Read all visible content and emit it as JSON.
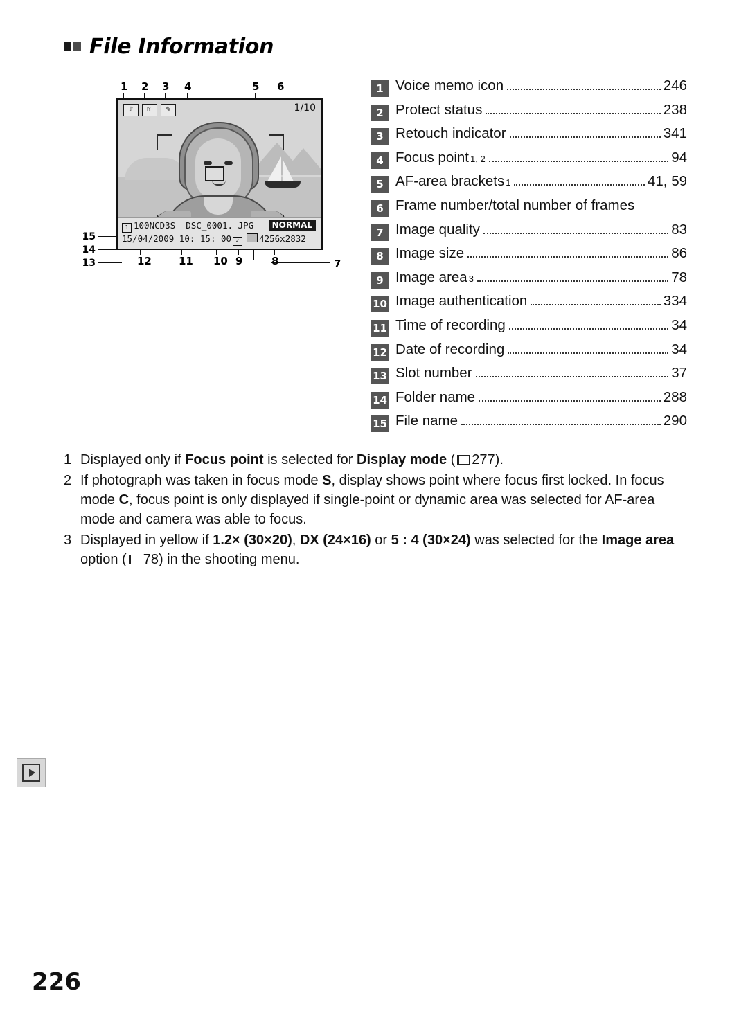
{
  "heading": {
    "title": "File Information"
  },
  "figure": {
    "callouts_top": [
      "1",
      "2",
      "3",
      "4",
      "5",
      "6"
    ],
    "callouts_bottom": [
      "12",
      "11",
      "10",
      "9",
      "8"
    ],
    "callouts_left": [
      "15",
      "14",
      "13"
    ],
    "callouts_right": [
      "7"
    ],
    "monitor": {
      "icons": [
        "voice-memo-icon",
        "protect-icon",
        "retouch-icon"
      ],
      "frame_counter": "1/10",
      "file_folder": "100NCD3S",
      "file_name": "DSC_0001. JPG",
      "quality_badge": "NORMAL",
      "date": "15/04/2009",
      "time": "10: 15: 00",
      "image_size": "4256x2832"
    }
  },
  "legend": [
    {
      "num": "1",
      "label": "Voice memo icon",
      "page": "246",
      "dots": true
    },
    {
      "num": "2",
      "label": "Protect status",
      "page": "238",
      "dots": true
    },
    {
      "num": "3",
      "label": "Retouch indicator",
      "page": "341",
      "dots": true
    },
    {
      "num": "4",
      "label": "Focus point",
      "sup": "1, 2",
      "page": "94",
      "dots": true
    },
    {
      "num": "5",
      "label": "AF-area brackets",
      "sup": "1",
      "page": "41, 59",
      "dots": true
    },
    {
      "num": "6",
      "label": "Frame number/total number of frames",
      "page": "",
      "dots": false
    },
    {
      "num": "7",
      "label": "Image quality",
      "page": "83",
      "dots": true
    },
    {
      "num": "8",
      "label": "Image size",
      "page": "86",
      "dots": true
    },
    {
      "num": "9",
      "label": "Image area",
      "sup": "3",
      "page": "78",
      "dots": true
    },
    {
      "num": "10",
      "label": "Image authentication",
      "page": "334",
      "dots": true
    },
    {
      "num": "11",
      "label": "Time of recording",
      "page": "34",
      "dots": true
    },
    {
      "num": "12",
      "label": "Date of recording",
      "page": "34",
      "dots": true
    },
    {
      "num": "13",
      "label": "Slot number",
      "page": "37",
      "dots": true
    },
    {
      "num": "14",
      "label": "Folder name",
      "page": "288",
      "dots": true
    },
    {
      "num": "15",
      "label": "File name",
      "page": "290",
      "dots": true
    }
  ],
  "footnotes": {
    "n1": "1",
    "n2": "2",
    "n3": "3",
    "f1_a": "Displayed only if ",
    "f1_b": "Focus point",
    "f1_c": " is selected for ",
    "f1_d": "Display mode",
    "f1_e": " (",
    "f1_page": "277",
    "f1_f": ").",
    "f2_a": "If photograph was taken in focus mode ",
    "f2_b": "S",
    "f2_c": ", display shows point where focus first locked. In focus mode ",
    "f2_d": "C",
    "f2_e": ", focus point is only displayed if single-point or dynamic area was selected for AF-area mode and camera was able to focus.",
    "f3_a": "Displayed in yellow if ",
    "f3_b": "1.2× (30×20)",
    "f3_c": ", ",
    "f3_d": "DX (24×16)",
    "f3_e": " or ",
    "f3_f": "5 : 4 (30×24)",
    "f3_g": " was selected for the ",
    "f3_h": "Image area",
    "f3_i": " option (",
    "f3_page": "78",
    "f3_j": ") in the shooting menu."
  },
  "tab_icon": {
    "name": "playback-icon"
  },
  "page_number": "226"
}
